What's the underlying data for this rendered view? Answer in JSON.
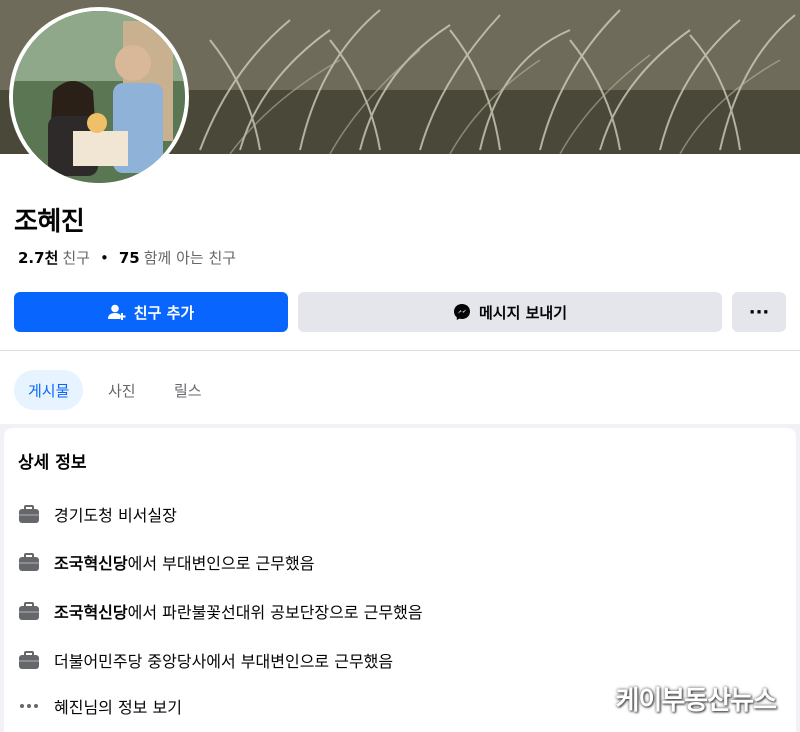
{
  "profile": {
    "name": "조혜진",
    "friends_count": "2.7천",
    "friends_label": "친구",
    "mutual_count": "75",
    "mutual_label": "함께 아는 친구"
  },
  "actions": {
    "add_friend": "친구 추가",
    "message": "메시지 보내기",
    "more": "···"
  },
  "tabs": [
    {
      "label": "게시물",
      "active": true
    },
    {
      "label": "사진",
      "active": false
    },
    {
      "label": "릴스",
      "active": false
    }
  ],
  "details": {
    "title": "상세 정보",
    "items": [
      {
        "bold": "",
        "text": "경기도청 비서실장",
        "icon": "briefcase-icon"
      },
      {
        "bold": "조국혁신당",
        "text": "에서 부대변인으로 근무했음",
        "icon": "briefcase-icon"
      },
      {
        "bold": "조국혁신당",
        "text": "에서 파란불꽃선대위 공보단장으로 근무했음",
        "icon": "briefcase-icon"
      },
      {
        "bold": "",
        "text": "더불어민주당 중앙당사에서 부대변인으로 근무했음",
        "icon": "briefcase-icon"
      }
    ],
    "see_more": "혜진님의 정보 보기",
    "see_more_icon": "more-dots-icon"
  },
  "watermark": "케이부동산뉴스",
  "colors": {
    "accent": "#0866ff",
    "active_tab_bg": "#e7f3ff",
    "secondary_button": "#e4e6eb"
  }
}
